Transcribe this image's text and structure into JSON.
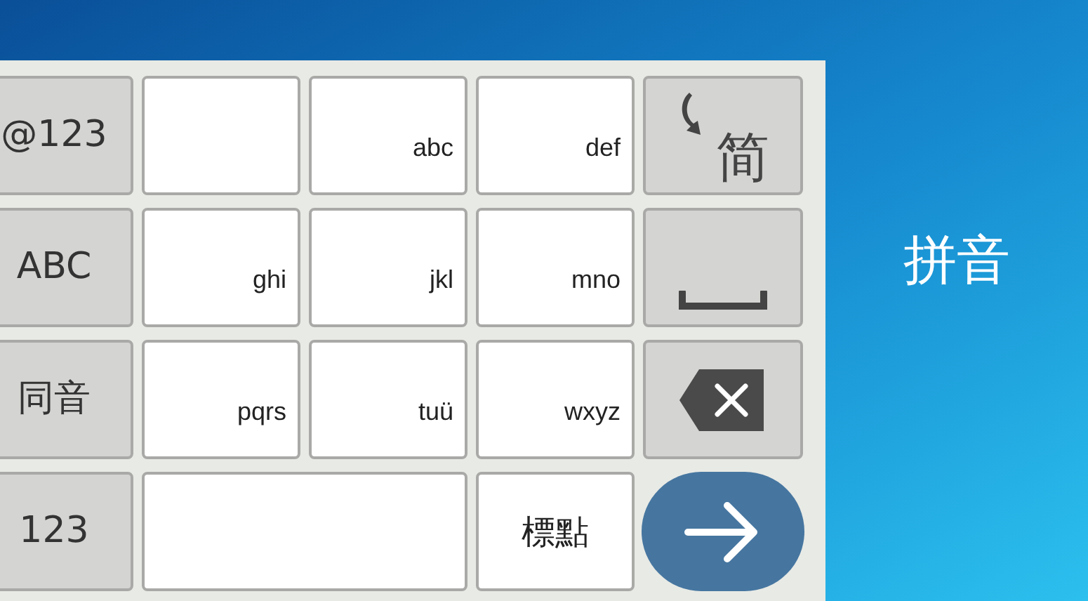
{
  "keys": [
    {
      "kind": "mode",
      "label": "@123"
    },
    {
      "kind": "letters"
    },
    {
      "kind": "letters",
      "label": "abc"
    },
    {
      "kind": "letters",
      "label": "def"
    },
    {
      "kind": "convert",
      "label": "简"
    },
    {
      "kind": "mode",
      "label": "ABC"
    },
    {
      "kind": "letters",
      "label": "ghi"
    },
    {
      "kind": "letters",
      "label": "jkl"
    },
    {
      "kind": "letters",
      "label": "mno"
    },
    {
      "kind": "space"
    },
    {
      "kind": "mode",
      "label": "同音"
    },
    {
      "kind": "letters",
      "label": "pqrs"
    },
    {
      "kind": "letters",
      "label": "tuü"
    },
    {
      "kind": "letters",
      "label": "wxyz"
    },
    {
      "kind": "backspace"
    },
    {
      "kind": "mode",
      "label": "123"
    },
    {
      "kind": "wide"
    },
    {
      "kind": "symbol",
      "label": "標點"
    },
    {
      "kind": "enter"
    }
  ],
  "input_mode": "拼音"
}
